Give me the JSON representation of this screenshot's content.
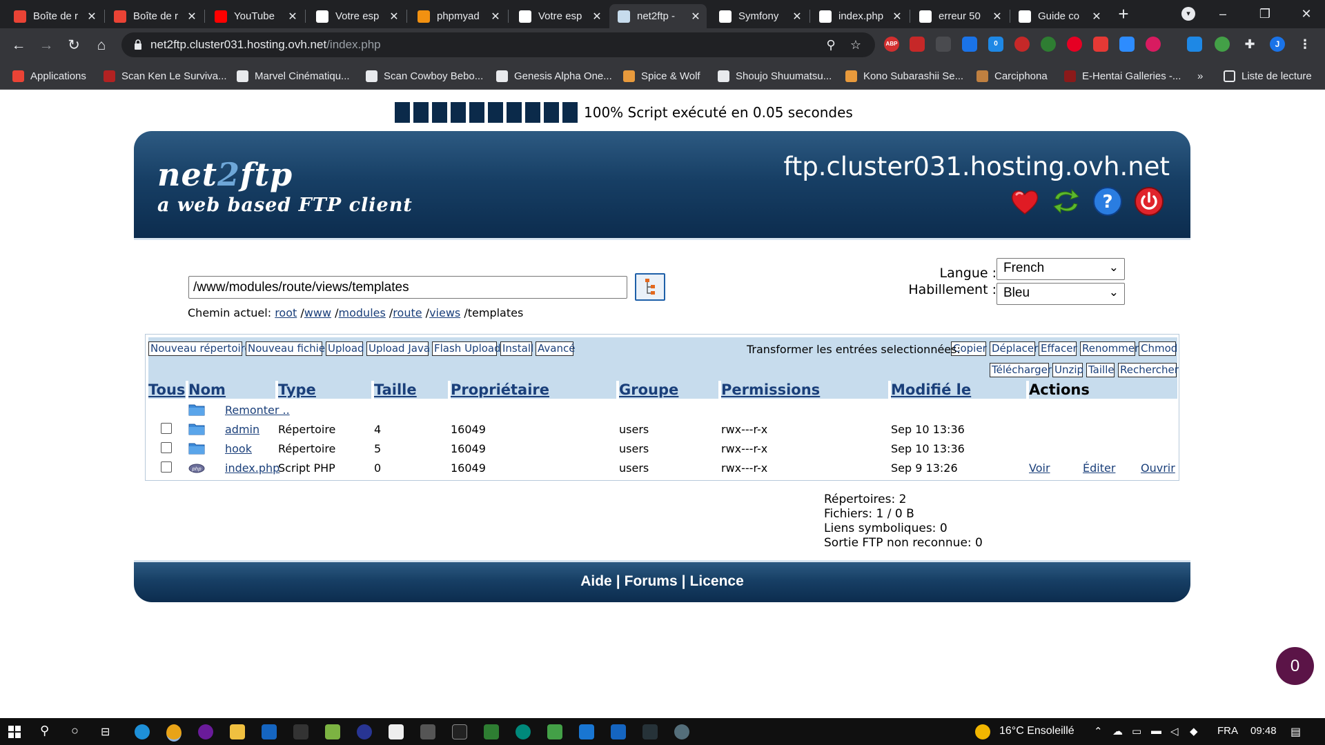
{
  "browser": {
    "tabs": [
      {
        "title": "Boîte de r",
        "icon": "gmail-icon",
        "color": "#ea4335"
      },
      {
        "title": "Boîte de r",
        "icon": "gmail-icon",
        "color": "#ea4335"
      },
      {
        "title": "YouTube",
        "icon": "youtube-icon",
        "color": "#ff0000"
      },
      {
        "title": "Votre esp",
        "icon": "ovh-icon",
        "color": "#ffffff"
      },
      {
        "title": "phpmyad",
        "icon": "phpmyadmin-icon",
        "color": "#f29111"
      },
      {
        "title": "Votre esp",
        "icon": "ovh-icon",
        "color": "#ffffff"
      },
      {
        "title": "net2ftp -",
        "icon": "net2ftp-icon",
        "color": "#c7dced"
      },
      {
        "title": "Symfony",
        "icon": "symfony-icon",
        "color": "#ffffff"
      },
      {
        "title": "index.php",
        "icon": "google-icon",
        "color": "#ffffff"
      },
      {
        "title": "erreur 50",
        "icon": "google-icon",
        "color": "#ffffff"
      },
      {
        "title": "Guide co",
        "icon": "guide-icon",
        "color": "#ffffff"
      }
    ],
    "active_tab": 6,
    "url_host": "net2ftp.cluster031.hosting.ovh.net",
    "url_path": "/index.php",
    "bookmarks": [
      {
        "label": "Applications",
        "color": "#ea4335"
      },
      {
        "label": "Scan Ken Le Surviva...",
        "color": "#b22222"
      },
      {
        "label": "Marvel Cinématiqu...",
        "color": "#e8eaed"
      },
      {
        "label": "Scan Cowboy Bebo...",
        "color": "#e8eaed"
      },
      {
        "label": "Genesis Alpha One...",
        "color": "#e8eaed"
      },
      {
        "label": "Spice & Wolf",
        "color": "#e89a3c"
      },
      {
        "label": "Shoujo Shuumatsu...",
        "color": "#e8eaed"
      },
      {
        "label": "Kono Subarashii Se...",
        "color": "#e89a3c"
      },
      {
        "label": "Carciphona",
        "color": "#c08040"
      },
      {
        "label": "E-Hentai Galleries -...",
        "color": "#8b1a1a"
      }
    ],
    "more_bookmarks": "»",
    "reading_list": "Liste de lecture",
    "extension_abp": "ABP",
    "extension_count": "0",
    "profile_initial": "J"
  },
  "page": {
    "progress_text": "100% Script exécuté en 0.05 secondes",
    "progress_blocks": 10,
    "logo_line1_a": "net",
    "logo_line1_b": "2",
    "logo_line1_c": "ftp",
    "logo_line2": "a web based FTP client",
    "hostname": "ftp.cluster031.hosting.ovh.net",
    "directory_value": "/www/modules/route/views/templates",
    "path_label": "Chemin actuel:",
    "path_links": [
      "root",
      "www",
      "modules",
      "route",
      "views"
    ],
    "path_current": "templates",
    "language_label": "Langue :",
    "language_value": "French",
    "skin_label": "Habillement :",
    "skin_value": "Bleu",
    "left_buttons": [
      "Nouveau répertoire",
      "Nouveau fichier",
      "Upload",
      "Upload Java",
      "Flash Upload",
      "Install",
      "Avancé"
    ],
    "transform_label": "Transformer les entrées selectionnées:",
    "right_buttons_row1": [
      "Copier",
      "Déplacer",
      "Effacer",
      "Renommer",
      "Chmod"
    ],
    "right_buttons_row2": [
      "Télécharger",
      "Unzip",
      "Taille",
      "Rechercher"
    ],
    "columns": [
      "Tous",
      "Nom",
      "Type",
      "Taille",
      "Propriétaire",
      "Groupe",
      "Permissions",
      "Modifié le",
      "Actions"
    ],
    "up_label": "Remonter ..",
    "rows": [
      {
        "name": "admin",
        "type": "Répertoire",
        "size": "4",
        "owner": "16049",
        "group": "users",
        "perms": "rwx---r-x",
        "modified": "Sep 10 13:36",
        "icon": "folder-icon"
      },
      {
        "name": "hook",
        "type": "Répertoire",
        "size": "5",
        "owner": "16049",
        "group": "users",
        "perms": "rwx---r-x",
        "modified": "Sep 10 13:36",
        "icon": "folder-icon"
      },
      {
        "name": "index.php",
        "type": "Script PHP",
        "size": "0",
        "owner": "16049",
        "group": "users",
        "perms": "rwx---r-x",
        "modified": "Sep 9 13:26",
        "icon": "php-file-icon"
      }
    ],
    "row_actions": [
      "Voir",
      "Éditer",
      "Ouvrir"
    ],
    "stats": [
      "Répertoires: 2",
      "Fichiers: 1 / 0 B",
      "Liens symboliques: 0",
      "Sortie FTP non reconnue: 0"
    ],
    "footer_links": [
      "Aide",
      "Forums",
      "Licence"
    ],
    "footer_sep": "|",
    "chat_badge": "0"
  },
  "taskbar": {
    "weather": "16°C  Ensoleillé",
    "language": "FRA",
    "time": "09:48"
  },
  "colors": {
    "header_dark": "#0c2c4e",
    "header_light": "#2d5a82",
    "table_header_bg": "#c7dced",
    "link": "#1a3f7a",
    "badge": "#5b1447"
  }
}
